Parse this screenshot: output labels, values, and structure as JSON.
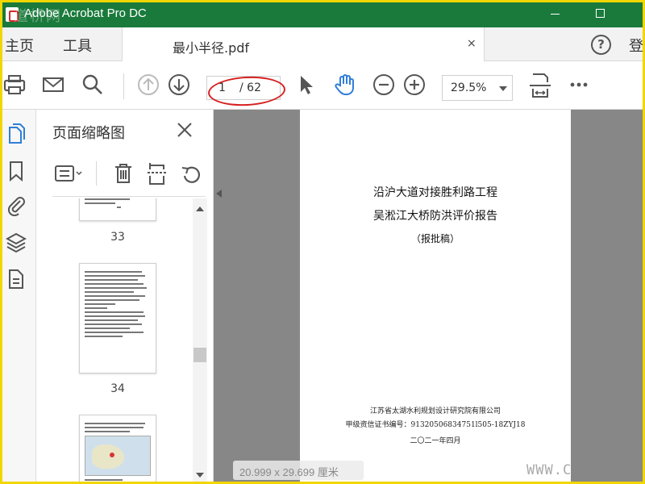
{
  "window": {
    "title": "Adobe Acrobat Pro DC",
    "watermark_top": "道桥网"
  },
  "tabbar": {
    "home": "主页",
    "tools": "工具",
    "doc_tab": "最小半径.pdf",
    "close_glyph": "×",
    "help_glyph": "?",
    "login": "登"
  },
  "toolbar": {
    "page_current": "1",
    "page_total": "/ 62",
    "zoom": "29.5%"
  },
  "thumbnail_panel": {
    "title": "页面缩略图",
    "pages": [
      {
        "label": "33"
      },
      {
        "label": "34"
      },
      {
        "label": ""
      }
    ]
  },
  "document": {
    "title_line1": "沿沪大道对接胜利路工程",
    "title_line2": "吴淞江大桥防洪评价报告",
    "title_line3": "（报批稿）",
    "footer_org": "江苏省太湖水利规划设计研究院有限公司",
    "footer_cert": "甲级资信证书编号：91320506834751l505-18ZYJ18",
    "footer_date": "二〇二一年四月",
    "size_indicator": "20.999 x 29.699 厘米"
  },
  "overlay": {
    "watermark_bottom": "WWW.C"
  },
  "colors": {
    "title_bar": "#1a7a3c",
    "frame_border": "#f1d600",
    "accent_blue": "#2f7ed8",
    "annotation_red": "#d62020",
    "doc_background": "#878787"
  }
}
